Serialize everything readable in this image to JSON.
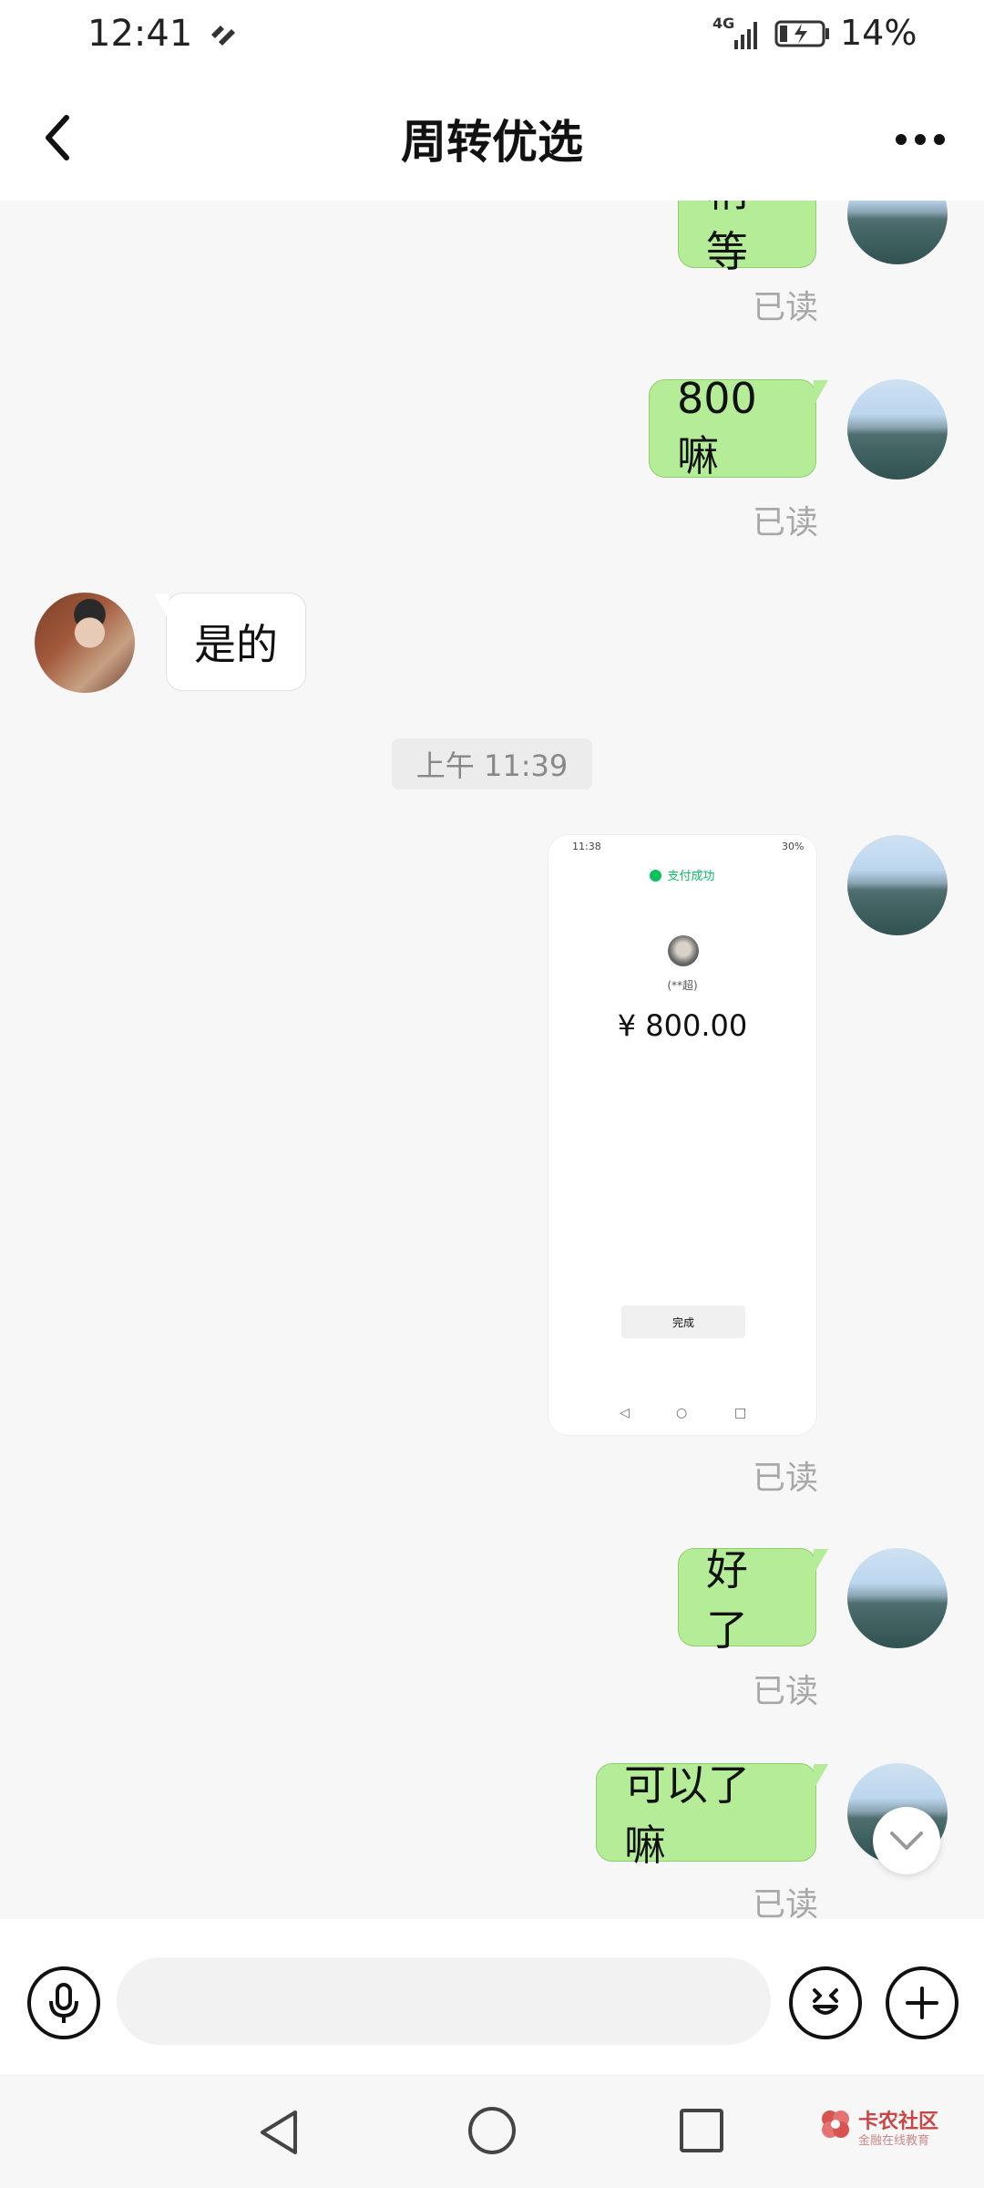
{
  "status_bar": {
    "time": "12:41",
    "network": "4G",
    "battery_percent": "14%"
  },
  "header": {
    "title": "周转优选"
  },
  "messages": [
    {
      "side": "me",
      "text": "稍等",
      "status": "已读"
    },
    {
      "side": "me",
      "text": "800嘛",
      "status": "已读"
    },
    {
      "side": "other",
      "text": "是的"
    },
    {
      "side": "system",
      "text": "上午 11:39"
    },
    {
      "side": "me",
      "type": "image",
      "status": "已读"
    },
    {
      "side": "me",
      "text": "好了",
      "status": "已读"
    },
    {
      "side": "me",
      "text": "可以了嘛",
      "status": "已读"
    }
  ],
  "payment_screenshot": {
    "time": "11:38",
    "battery": "30%",
    "status": "支付成功",
    "payee": "(**超)",
    "amount": "¥ 800.00",
    "done_button": "完成"
  },
  "input_bar": {
    "placeholder": ""
  },
  "watermark": {
    "title": "卡农社区",
    "subtitle": "金融在线教育"
  },
  "colors": {
    "my_bubble": "#b5ec97",
    "other_bubble": "#ffffff",
    "background": "#f7f7f7",
    "success_green": "#07c160"
  },
  "icons": [
    "back-icon",
    "more-icon",
    "microphone-icon",
    "emoji-icon",
    "plus-icon",
    "chevron-down-icon",
    "nav-back-icon",
    "nav-home-icon",
    "nav-recent-icon"
  ]
}
